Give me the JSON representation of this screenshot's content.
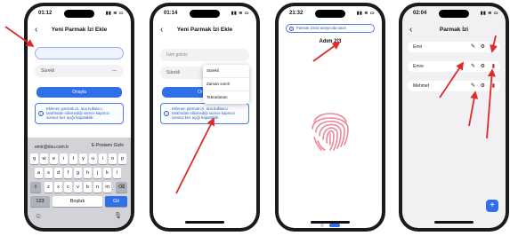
{
  "screen1": {
    "time": "01:12",
    "title": "Yeni Parmak İzi Ekle",
    "name_value": "",
    "duration_value": "Sürekli",
    "dash": "—",
    "confirm": "Onayla",
    "info": "Eklenen parmak izi, ana kullanıcı tarafından silinmediği sürece kapınızı sonsuz kez açığı kapatabilir.",
    "suggestions": [
      "emir@dsu.com.tr",
      "E-Postamı Gizle"
    ],
    "row1": [
      "q",
      "w",
      "e",
      "r",
      "t",
      "y",
      "u",
      "i",
      "o",
      "p"
    ],
    "row2": [
      "a",
      "s",
      "d",
      "f",
      "g",
      "h",
      "j",
      "k",
      "l"
    ],
    "row3": [
      "z",
      "x",
      "c",
      "v",
      "b",
      "n",
      "m"
    ],
    "key_123": "123",
    "key_space": "Boşluk",
    "key_go": "Git",
    "key_shift": "⇧",
    "key_del": "⌫",
    "emoji_icon": "☺",
    "mic_icon": "🎙"
  },
  "screen2": {
    "time": "01:14",
    "title": "Yeni Parmak İzi Ekle",
    "name_placeholder": "İsim giriniz",
    "duration_value": "Sürekli",
    "confirm": "Onayla",
    "info": "Eklenen parmak izi, ana kullanıcı tarafından silinmediği sürece kapınızı sonsuz kez açığı kapatabilir.",
    "options": [
      "Sürekli",
      "Zaman sınırlı",
      "Tekrarlanan"
    ]
  },
  "screen3": {
    "time": "21:32",
    "toast": "Parmak izinizi tarayıcıda tutun",
    "step": "Adım 2/3",
    "fingerprint_color": "#e8738a",
    "progress_step": 2,
    "progress_total": 3
  },
  "screen4": {
    "time": "02:04",
    "title": "Parmak İzi",
    "items": [
      "Emir",
      "Emre",
      "Mehmet"
    ],
    "add": "+"
  },
  "colors": {
    "accent": "#2f6fe8",
    "arrow": "#e02a2a",
    "delete": "#e01b24"
  }
}
